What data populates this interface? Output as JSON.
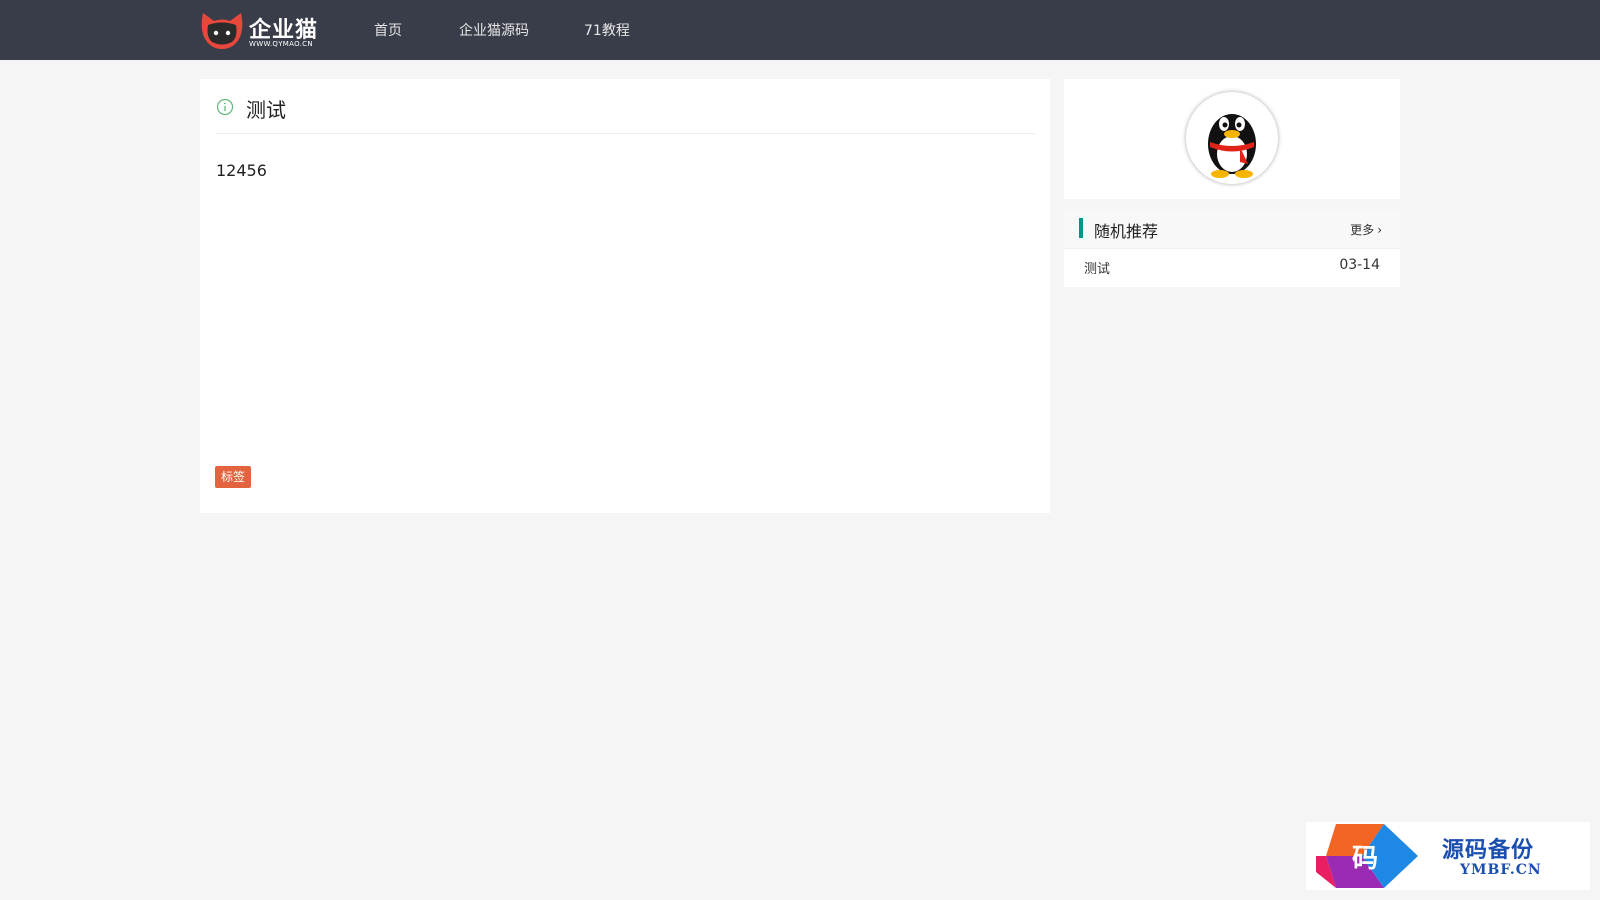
{
  "header": {
    "logo_text": "企业猫",
    "logo_sub": "WWW.QYMAO.CN",
    "nav": [
      "首页",
      "企业猫源码",
      "71教程"
    ]
  },
  "article": {
    "title": "测试",
    "body": "12456",
    "tag": "标签"
  },
  "sidebar": {
    "recommend_title": "随机推荐",
    "more_label": "更多",
    "items": [
      {
        "title": "测试",
        "date": "03-14"
      }
    ]
  },
  "watermark": {
    "icon_char": "码",
    "title": "源码备份",
    "sub": "YMBF.CN"
  },
  "colors": {
    "topbar": "#393d49",
    "accent": "#009688",
    "tag": "#e3633e"
  }
}
